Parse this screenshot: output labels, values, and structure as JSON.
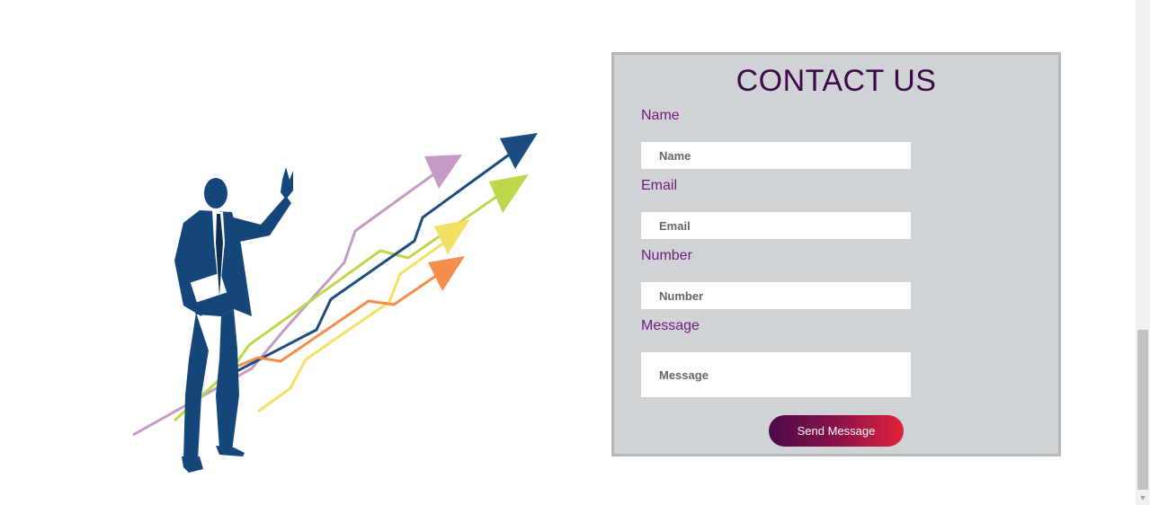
{
  "contact": {
    "title": "CONTACT US",
    "name_label": "Name",
    "name_placeholder": "Name",
    "email_label": "Email",
    "email_placeholder": "Email",
    "number_label": "Number",
    "number_placeholder": "Number",
    "message_label": "Message",
    "message_placeholder": "Message",
    "send_label": "Send Message"
  },
  "illustration": {
    "icon": "businessman-growth-arrows-illustration",
    "colors": {
      "suit": "#14467a",
      "arrow_purple": "#c39bc4",
      "arrow_blue": "#1c4b80",
      "arrow_green": "#bcd84a",
      "arrow_yellow": "#f4e064",
      "arrow_orange": "#f58d4c"
    }
  },
  "theme": {
    "card_bg": "#d0d3d6",
    "title_color": "#3c0a45",
    "label_color": "#6e1a7a",
    "button_gradient_start": "#4a0a4c",
    "button_gradient_end": "#e0223a"
  },
  "scrollbar": {
    "down_arrow_icon": "triangle-down-icon"
  }
}
